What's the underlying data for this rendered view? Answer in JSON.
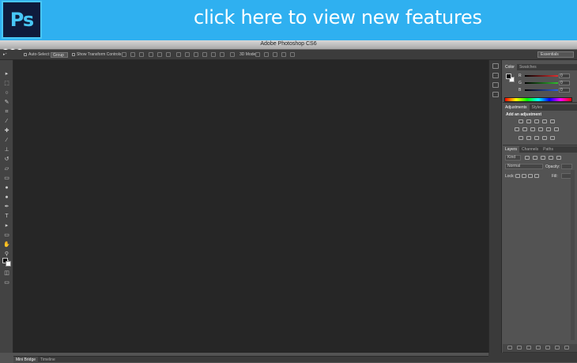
{
  "banner": {
    "logo_text": "Ps",
    "link_text": "click here to view new features",
    "bg_color": "#2fb0f0"
  },
  "window": {
    "title": "Adobe Photoshop CS6"
  },
  "options_bar": {
    "auto_select_label": "Auto-Select:",
    "auto_select_value": "Group",
    "transform_label": "Show Transform Controls",
    "mode_label": "3D Mode:",
    "workspace": "Essentials"
  },
  "color_panel": {
    "tabs": [
      "Color",
      "Swatches"
    ],
    "channels": [
      {
        "label": "R",
        "value": "0",
        "color": "#e03030"
      },
      {
        "label": "G",
        "value": "0",
        "color": "#30c030"
      },
      {
        "label": "B",
        "value": "0",
        "color": "#3060e0"
      }
    ]
  },
  "adjustments_panel": {
    "tabs": [
      "Adjustments",
      "Styles"
    ],
    "title": "Add an adjustment"
  },
  "layers_panel": {
    "tabs": [
      "Layers",
      "Channels",
      "Paths"
    ],
    "kind_label": "Kind",
    "blend_mode": "Normal",
    "opacity_label": "Opacity:",
    "lock_label": "Lock:",
    "fill_label": "Fill:"
  },
  "bottom_tabs": [
    "Mini Bridge",
    "Timeline"
  ],
  "colors": {
    "canvas": "#262626",
    "chrome": "#535353"
  }
}
